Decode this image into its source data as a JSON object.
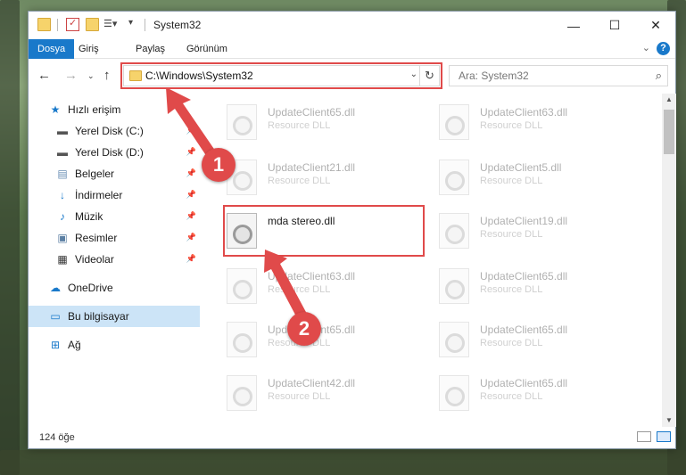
{
  "window": {
    "title": "System32",
    "minimize_glyph": "—",
    "maximize_glyph": "☐",
    "close_glyph": "✕"
  },
  "ribbon": {
    "tabs": [
      {
        "label": "Dosya",
        "active": true
      },
      {
        "label": "Giriş",
        "active": false
      },
      {
        "label": "Paylaş",
        "active": false
      },
      {
        "label": "Görünüm",
        "active": false
      }
    ],
    "help": "?"
  },
  "nav": {
    "address": "C:\\Windows\\System32",
    "search_placeholder": "Ara: System32"
  },
  "sidebar": {
    "items": [
      {
        "label": "Hızlı erişim",
        "icon": "star-icon",
        "pinned": false
      },
      {
        "label": "Yerel Disk (C:)",
        "icon": "drive-icon",
        "pinned": true
      },
      {
        "label": "Yerel Disk (D:)",
        "icon": "drive-icon",
        "pinned": true
      },
      {
        "label": "Belgeler",
        "icon": "documents-icon",
        "pinned": true
      },
      {
        "label": "İndirmeler",
        "icon": "download-icon",
        "pinned": true
      },
      {
        "label": "Müzik",
        "icon": "music-icon",
        "pinned": true
      },
      {
        "label": "Resimler",
        "icon": "pictures-icon",
        "pinned": true
      },
      {
        "label": "Videolar",
        "icon": "video-icon",
        "pinned": true
      },
      {
        "label": "OneDrive",
        "icon": "cloud-icon",
        "pinned": false
      },
      {
        "label": "Bu bilgisayar",
        "icon": "computer-icon",
        "pinned": false,
        "selected": true
      },
      {
        "label": "Ağ",
        "icon": "network-icon",
        "pinned": false
      }
    ]
  },
  "files": [
    {
      "name": "UpdateClient65.dll",
      "type": "Resource DLL",
      "faded": true
    },
    {
      "name": "UpdateClient63.dll",
      "type": "Resource DLL",
      "faded": true
    },
    {
      "name": "UpdateClient21.dll",
      "type": "Resource DLL",
      "faded": true
    },
    {
      "name": "UpdateClient5.dll",
      "type": "Resource DLL",
      "faded": true
    },
    {
      "name": "mda stereo.dll",
      "type": "",
      "faded": false
    },
    {
      "name": "UpdateClient19.dll",
      "type": "Resource DLL",
      "faded": true
    },
    {
      "name": "UpdateClient63.dll",
      "type": "Resource DLL",
      "faded": true
    },
    {
      "name": "UpdateClient65.dll",
      "type": "Resource DLL",
      "faded": true
    },
    {
      "name": "UpdateClient65.dll",
      "type": "Resource DLL",
      "faded": true
    },
    {
      "name": "UpdateClient65.dll",
      "type": "Resource DLL",
      "faded": true
    },
    {
      "name": "UpdateClient42.dll",
      "type": "Resource DLL",
      "faded": true
    },
    {
      "name": "UpdateClient65.dll",
      "type": "Resource DLL",
      "faded": true
    }
  ],
  "status": {
    "item_count": "124 öğe"
  },
  "annotations": {
    "badge1": "1",
    "badge2": "2",
    "color": "#e04a4a"
  }
}
